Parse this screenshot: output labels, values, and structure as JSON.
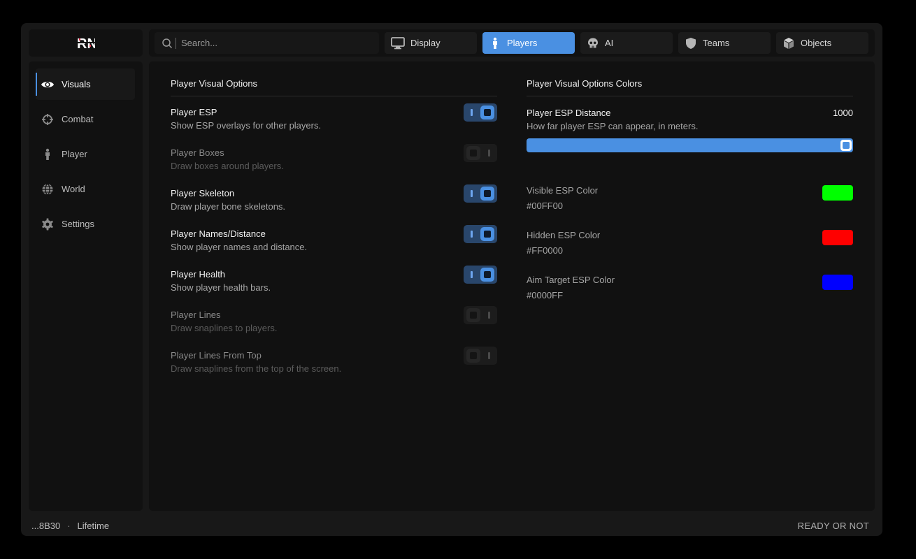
{
  "app": {
    "logo_text": "RN"
  },
  "search": {
    "placeholder": "Search..."
  },
  "tabs": [
    {
      "label": "Display",
      "icon": "monitor-icon",
      "active": false
    },
    {
      "label": "Players",
      "icon": "person-icon",
      "active": true
    },
    {
      "label": "AI",
      "icon": "skull-icon",
      "active": false
    },
    {
      "label": "Teams",
      "icon": "shield-icon",
      "active": false
    },
    {
      "label": "Objects",
      "icon": "cube-icon",
      "active": false
    }
  ],
  "sidebar": {
    "items": [
      {
        "label": "Visuals",
        "icon": "eye-icon",
        "active": true
      },
      {
        "label": "Combat",
        "icon": "crosshair-icon",
        "active": false
      },
      {
        "label": "Player",
        "icon": "person-icon",
        "active": false
      },
      {
        "label": "World",
        "icon": "globe-icon",
        "active": false
      },
      {
        "label": "Settings",
        "icon": "gear-icon",
        "active": false
      }
    ]
  },
  "left_section": {
    "title": "Player Visual Options",
    "options": [
      {
        "name": "Player ESP",
        "desc": "Show ESP overlays for other players.",
        "enabled": true
      },
      {
        "name": "Player Boxes",
        "desc": "Draw boxes around players.",
        "enabled": false
      },
      {
        "name": "Player Skeleton",
        "desc": "Draw player bone skeletons.",
        "enabled": true
      },
      {
        "name": "Player Names/Distance",
        "desc": "Show player names and distance.",
        "enabled": true
      },
      {
        "name": "Player Health",
        "desc": "Show player health bars.",
        "enabled": true
      },
      {
        "name": "Player Lines",
        "desc": "Draw snaplines to players.",
        "enabled": false
      },
      {
        "name": "Player Lines From Top",
        "desc": "Draw snaplines from the top of the screen.",
        "enabled": false
      }
    ]
  },
  "right_section": {
    "title": "Player Visual Options Colors",
    "slider": {
      "name": "Player ESP Distance",
      "desc": "How far player ESP can appear, in meters.",
      "value": "1000",
      "fill_fraction": 1.0
    },
    "colors": [
      {
        "name": "Visible ESP Color",
        "hex": "#00FF00",
        "color": "#00ff00"
      },
      {
        "name": "Hidden ESP Color",
        "hex": "#FF0000",
        "color": "#ff0000"
      },
      {
        "name": "Aim Target ESP Color",
        "hex": "#0000FF",
        "color": "#0000ff"
      }
    ]
  },
  "statusbar": {
    "id": "...8B30",
    "separator": "·",
    "license": "Lifetime",
    "status": "READY OR NOT"
  },
  "theme": {
    "accent": "#4a90e2"
  }
}
